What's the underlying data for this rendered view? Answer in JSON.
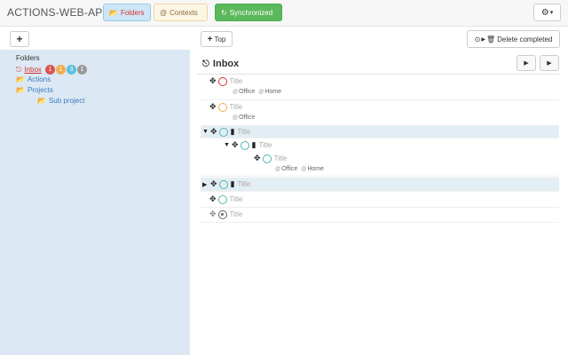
{
  "app": {
    "title": "ACTIONS-WEB-APP"
  },
  "nav": {
    "folders_label": "Folders",
    "contexts_label": "Contexts",
    "sync_label": "Synchronized",
    "gear_caret": "▾"
  },
  "toolbar": {
    "add_label": "+",
    "top_label": "Top",
    "delete_completed_label": "Delete completed"
  },
  "sidebar": {
    "heading": "Folders",
    "items": [
      {
        "label": "Inbox",
        "badges": [
          "1",
          "1",
          "3",
          "1"
        ]
      },
      {
        "label": "Actions"
      },
      {
        "label": "Projects"
      },
      {
        "label": "Sub project"
      }
    ]
  },
  "main": {
    "title": "Inbox",
    "tasks": [
      {
        "title": "Title",
        "contexts": [
          "Office",
          "Home"
        ]
      },
      {
        "title": "Title",
        "contexts": [
          "Office"
        ]
      },
      {
        "title": "Title"
      },
      {
        "title": "Title"
      },
      {
        "title": "Title",
        "contexts": [
          "Office",
          "Home"
        ]
      },
      {
        "title": "Title"
      },
      {
        "title": "Title"
      },
      {
        "title": "Title"
      }
    ]
  },
  "colors": {
    "accent_red": "#d9302c",
    "link_blue": "#3b7bbf",
    "sync_green": "#5cb85c",
    "sidebar_bg": "#dce9f4",
    "badge_red": "#d9534f",
    "badge_orange": "#f0ad4e",
    "badge_blue": "#5bc0de",
    "badge_gray": "#999999"
  },
  "icons": [
    "folder-open-icon",
    "at-icon",
    "refresh-icon",
    "gear-icon",
    "plus-icon",
    "inbox-icon",
    "play-icon",
    "move-icon",
    "circle-icon",
    "folder-icon",
    "caret-down-icon",
    "caret-right-icon",
    "trash-icon"
  ]
}
